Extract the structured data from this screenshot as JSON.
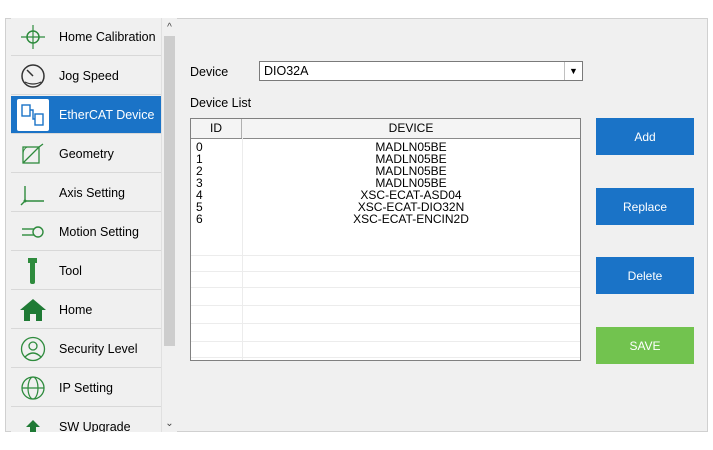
{
  "sidebar": {
    "items": [
      {
        "label": "Home Calibration",
        "icon": "crosshair-icon"
      },
      {
        "label": "Jog Speed",
        "icon": "gauge-icon"
      },
      {
        "label": "EtherCAT Device",
        "icon": "ethercat-icon",
        "active": true
      },
      {
        "label": "Geometry",
        "icon": "geometry-icon"
      },
      {
        "label": "Axis Setting",
        "icon": "axis-icon"
      },
      {
        "label": "Motion Setting",
        "icon": "motion-icon"
      },
      {
        "label": "Tool",
        "icon": "tool-icon"
      },
      {
        "label": "Home",
        "icon": "home-icon"
      },
      {
        "label": "Security Level",
        "icon": "user-icon"
      },
      {
        "label": "IP Setting",
        "icon": "globe-icon"
      },
      {
        "label": "SW Upgrade",
        "icon": "upgrade-icon"
      }
    ]
  },
  "device": {
    "label": "Device",
    "selected": "DIO32A"
  },
  "device_list": {
    "label": "Device List",
    "columns": [
      "ID",
      "DEVICE"
    ],
    "rows": [
      {
        "id": "0",
        "device": "MADLN05BE"
      },
      {
        "id": "1",
        "device": "MADLN05BE"
      },
      {
        "id": "2",
        "device": "MADLN05BE"
      },
      {
        "id": "3",
        "device": "MADLN05BE"
      },
      {
        "id": "4",
        "device": "XSC-ECAT-ASD04"
      },
      {
        "id": "5",
        "device": "XSC-ECAT-DIO32N"
      },
      {
        "id": "6",
        "device": "XSC-ECAT-ENCIN2D"
      }
    ]
  },
  "actions": {
    "add": "Add",
    "replace": "Replace",
    "delete": "Delete",
    "save": "SAVE"
  },
  "colors": {
    "accent": "#1a73c7",
    "save": "#72c34f"
  }
}
